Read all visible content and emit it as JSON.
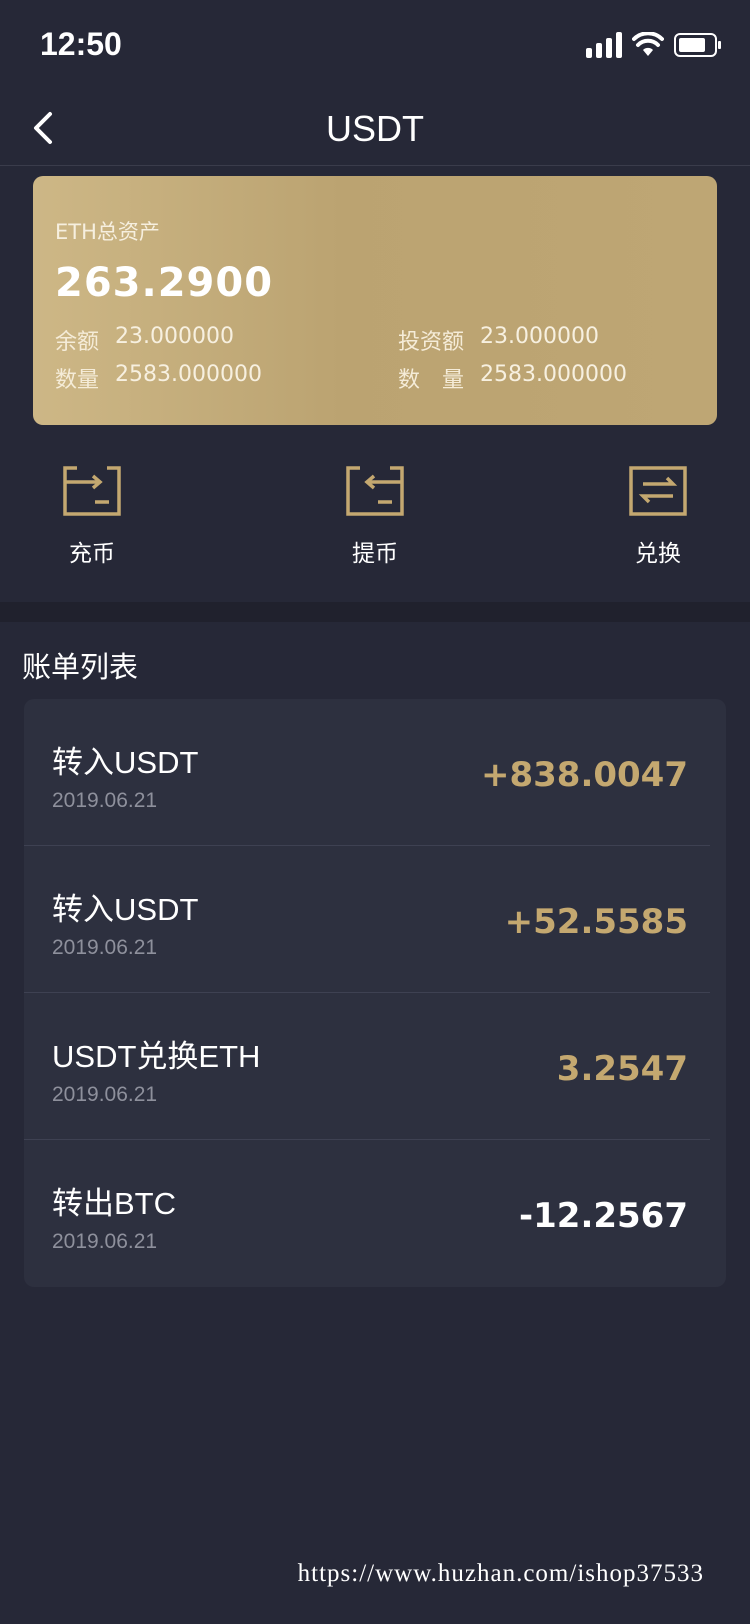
{
  "status_bar": {
    "time": "12:50"
  },
  "nav": {
    "title": "USDT"
  },
  "asset_card": {
    "label": "ETH总资产",
    "total": "263.2900",
    "balance_key": "余额",
    "balance_value": "23.000000",
    "invest_key": "投资额",
    "invest_value": "23.000000",
    "qty_key_left": "数量",
    "qty_value_left": "2583.000000",
    "qty_key_right": "数　量",
    "qty_value_right": "2583.000000"
  },
  "actions": [
    {
      "label": "充币",
      "icon": "deposit-icon"
    },
    {
      "label": "提币",
      "icon": "withdraw-icon"
    },
    {
      "label": "兑换",
      "icon": "exchange-icon"
    }
  ],
  "section": {
    "title": "账单列表"
  },
  "bills": [
    {
      "title": "转入USDT",
      "date": "2019.06.21",
      "amount": "+838.0047",
      "color": "#c4a870"
    },
    {
      "title": "转入USDT",
      "date": "2019.06.21",
      "amount": "+52.5585",
      "color": "#c4a870"
    },
    {
      "title": "USDT兑换ETH",
      "date": "2019.06.21",
      "amount": "3.2547",
      "color": "#c4a870"
    },
    {
      "title": "转出BTC",
      "date": "2019.06.21",
      "amount": "-12.2567",
      "color": "#ffffff"
    }
  ],
  "watermark": "https://www.huzhan.com/ishop37533",
  "colors": {
    "background": "#262837",
    "accent_gold": "#c4a870",
    "card_bg": "#2d303f"
  }
}
